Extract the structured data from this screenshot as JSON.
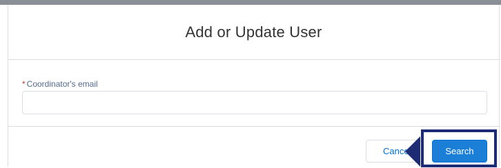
{
  "modal": {
    "title": "Add or Update User"
  },
  "form": {
    "required_marker": "*",
    "email_label": "Coordinator's email",
    "email_value": "",
    "email_placeholder": ""
  },
  "footer": {
    "cancel_label": "Cancel",
    "search_label": "Search"
  },
  "colors": {
    "primary": "#1b7fd8",
    "highlight": "#1d2a74",
    "required": "#c23934"
  }
}
